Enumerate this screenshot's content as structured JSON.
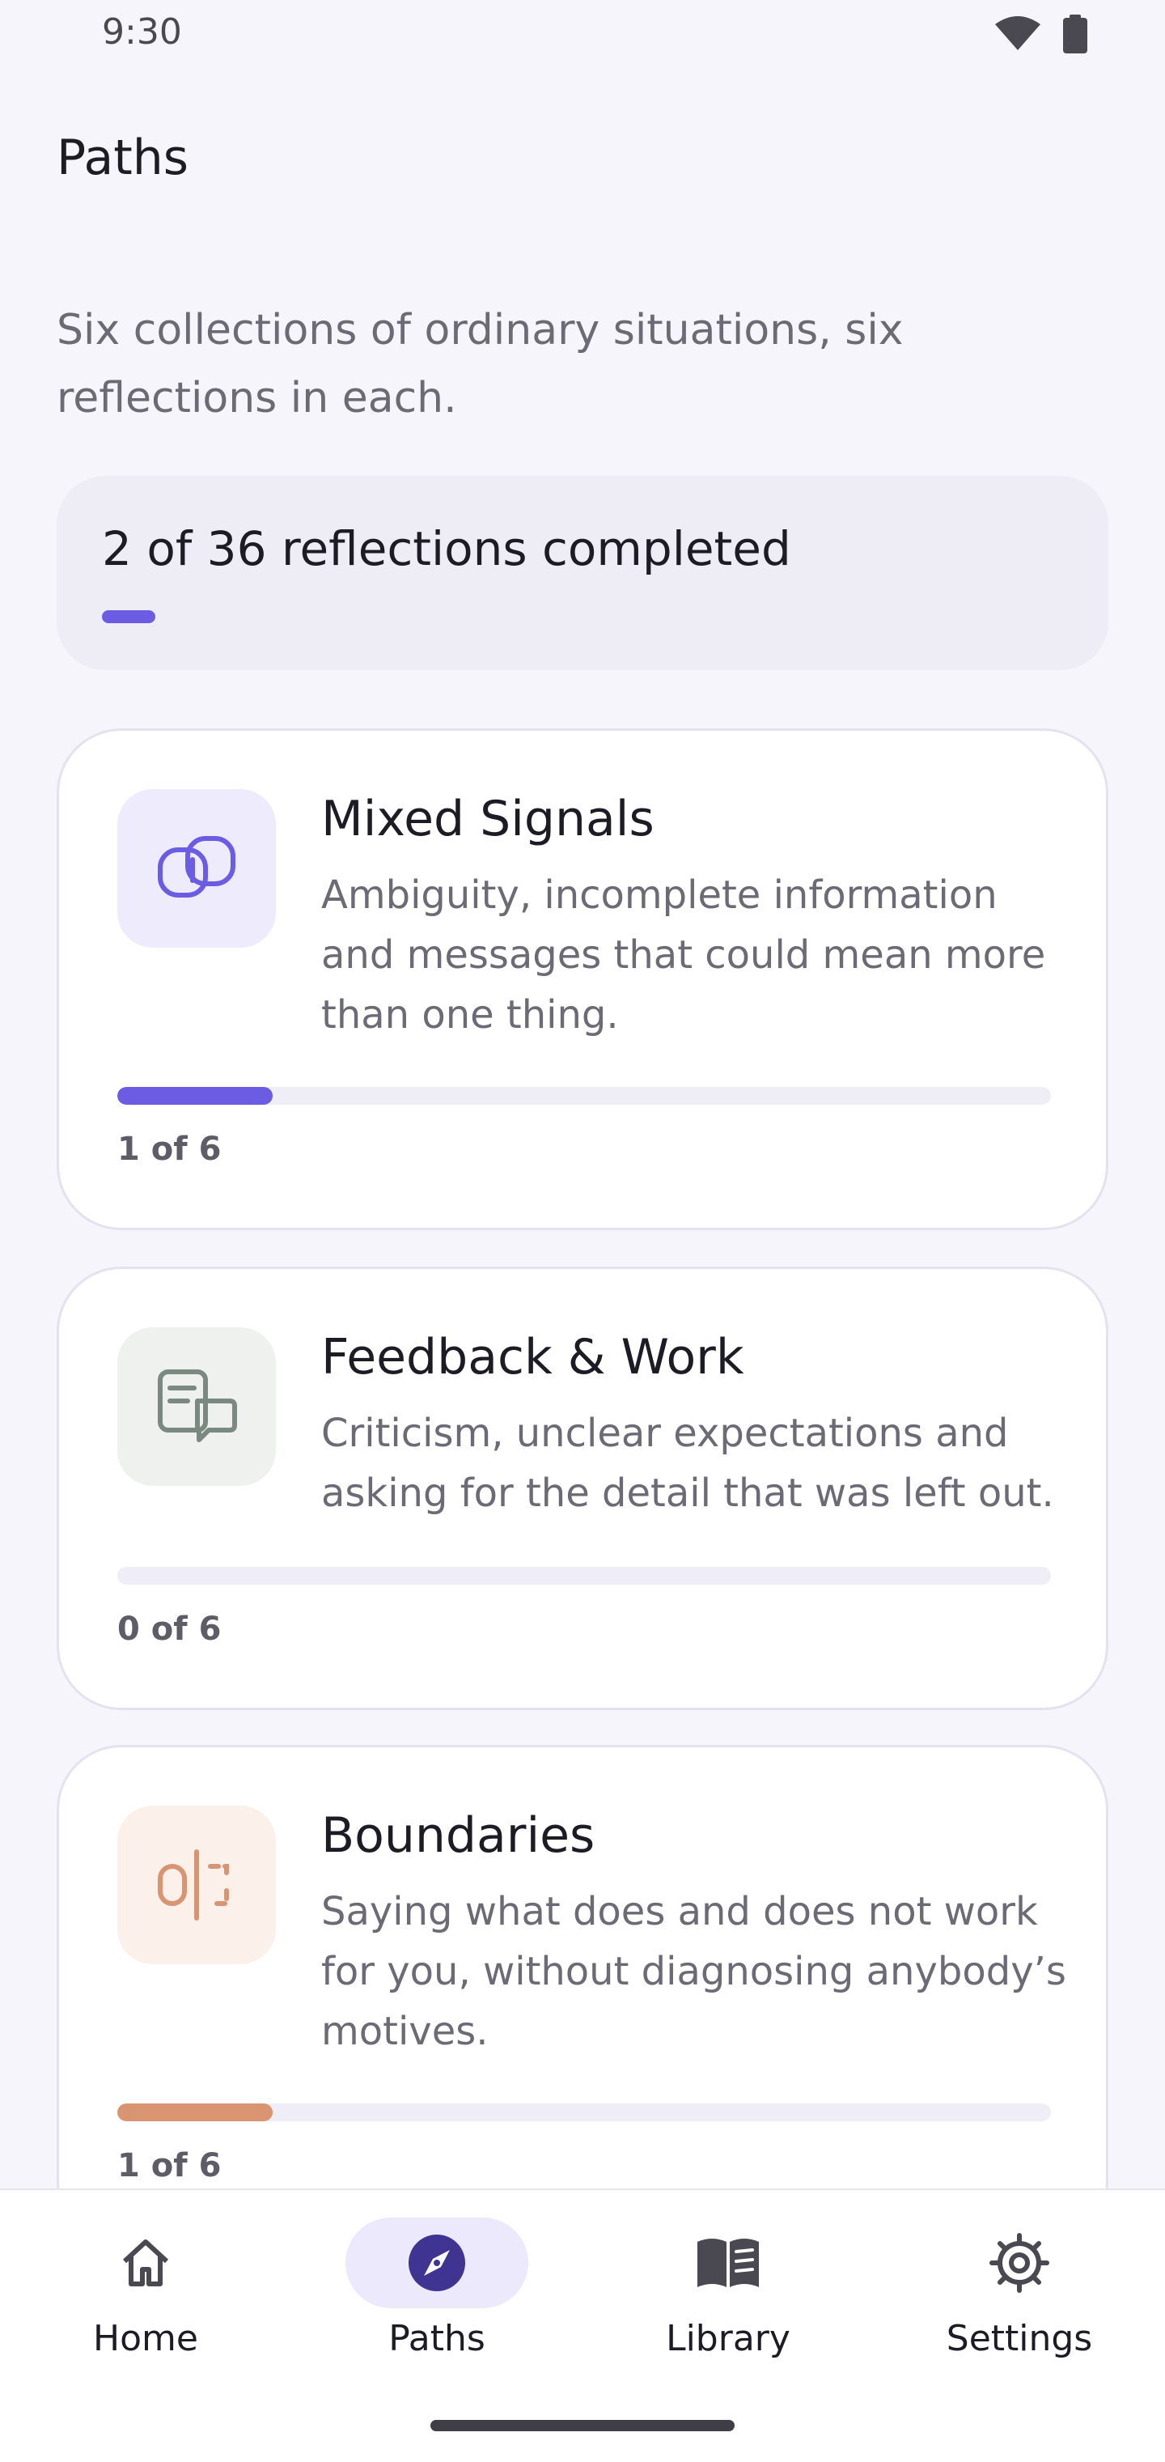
{
  "status_bar": {
    "time": "9:30"
  },
  "header": {
    "title": "Paths"
  },
  "intro": "Six collections of ordinary situations, six reflections in each.",
  "summary": {
    "text": "2 of 36 reflections completed",
    "completed": 2,
    "total": 36
  },
  "cards": [
    {
      "title": "Mixed Signals",
      "description": "Ambiguity, incomplete information and messages that could mean more than one thing.",
      "count_label": "1 of 6",
      "completed": 1,
      "total": 6,
      "icon": "overlapping-squares-icon",
      "icon_bg": "#eeebfc",
      "accent": "#6c5ce4"
    },
    {
      "title": "Feedback & Work",
      "description": "Criticism, unclear expectations and asking for the detail that was left out.",
      "count_label": "0 of 6",
      "completed": 0,
      "total": 6,
      "icon": "document-chat-icon",
      "icon_bg": "#eef1ee",
      "accent": "#7a8a80"
    },
    {
      "title": "Boundaries",
      "description": "Saying what does and does not work for you, without diagnosing anybody’s motives.",
      "count_label": "1 of 6",
      "completed": 1,
      "total": 6,
      "icon": "boundary-line-icon",
      "icon_bg": "#fbf0ea",
      "accent": "#d99572"
    }
  ],
  "nav": [
    {
      "label": "Home",
      "icon": "home-icon",
      "active": false
    },
    {
      "label": "Paths",
      "icon": "compass-icon",
      "active": true
    },
    {
      "label": "Library",
      "icon": "book-icon",
      "active": false
    },
    {
      "label": "Settings",
      "icon": "gear-icon",
      "active": false
    }
  ],
  "colors": {
    "accent": "#6c5ce4",
    "background": "#f6f5fb",
    "active_nav_pill": "#ebe9fb"
  }
}
